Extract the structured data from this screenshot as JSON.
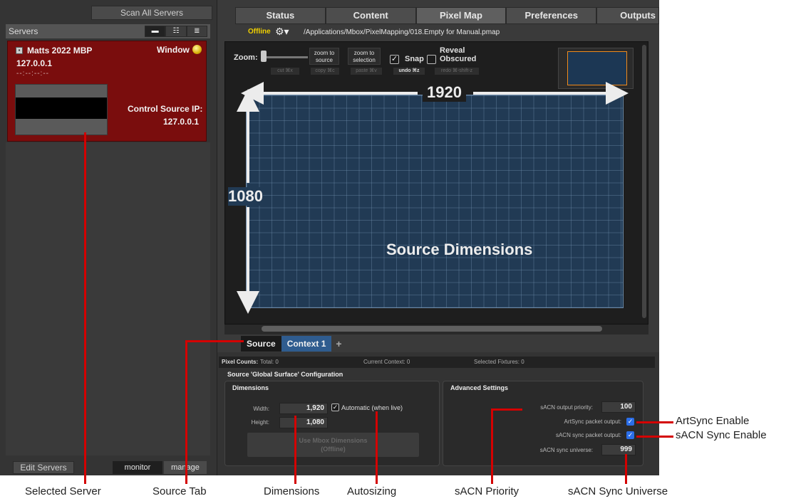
{
  "left_panel": {
    "scan_button": "Scan All Servers",
    "servers_label": "Servers",
    "view_buttons": [
      "▬",
      "☷",
      "≣"
    ],
    "server": {
      "name": "Matts 2022 MBP",
      "mode": "Window",
      "ip": "127.0.0.1",
      "time": "--:--:--:--",
      "control_source_label": "Control Source IP:",
      "control_source_ip": "127.0.0.1",
      "status_color": "#d9b30a"
    },
    "edit_servers": "Edit Servers",
    "monitor": "monitor",
    "manage": "manage"
  },
  "tabs": [
    "Status",
    "Content",
    "Pixel Map",
    "Preferences",
    "Outputs"
  ],
  "active_tab": "Pixel Map",
  "status_bar": {
    "state": "Offline",
    "path": "/Applications/Mbox/PixelMapping/018.Empty for Manual.pmap"
  },
  "canvas_toolbar": {
    "zoom_label": "Zoom:",
    "zoom_to_source": "zoom to\nsource",
    "zoom_to_selection": "zoom to\nselection",
    "snap_label": "Snap",
    "snap_checked": true,
    "reveal_label": "Reveal\nObscured",
    "reveal_checked": false,
    "edit_buttons": [
      "cut ⌘x",
      "copy ⌘c",
      "paste ⌘v",
      "undo ⌘z",
      "redo ⌘-shift-z"
    ]
  },
  "canvas": {
    "width_label": "1920",
    "height_label": "1080",
    "center_label": "Source Dimensions"
  },
  "context_tabs": {
    "source": "Source",
    "context": "Context 1",
    "add": "+"
  },
  "pixel_counts": {
    "label": "Pixel Counts:",
    "total": "Total: 0",
    "current": "Current Context: 0",
    "selected": "Selected Fixtures: 0"
  },
  "config": {
    "title": "Source 'Global Surface' Configuration",
    "dimensions": {
      "title": "Dimensions",
      "width_label": "Width:",
      "width": "1,920",
      "height_label": "Height:",
      "height": "1,080",
      "automatic": "Automatic (when live)",
      "automatic_checked": true,
      "use_button": "Use Mbox Dimensions\n(Offline)"
    },
    "advanced": {
      "title": "Advanced Settings",
      "sacn_priority_label": "sACN output priority:",
      "sacn_priority": "100",
      "artsync_label": "ArtSync packet output:",
      "artsync_checked": true,
      "sacn_sync_label": "sACN sync packet output:",
      "sacn_sync_checked": true,
      "sacn_universe_label": "sACN sync universe:",
      "sacn_universe": "999"
    }
  },
  "callouts": {
    "selected_server": "Selected Server",
    "source_tab": "Source Tab",
    "dimensions": "Dimensions",
    "autosizing": "Autosizing",
    "sacn_priority": "sACN Priority",
    "sacn_sync_universe": "sACN Sync Universe",
    "artsync_enable": "ArtSync Enable",
    "sacn_sync_enable": "sACN Sync Enable"
  }
}
